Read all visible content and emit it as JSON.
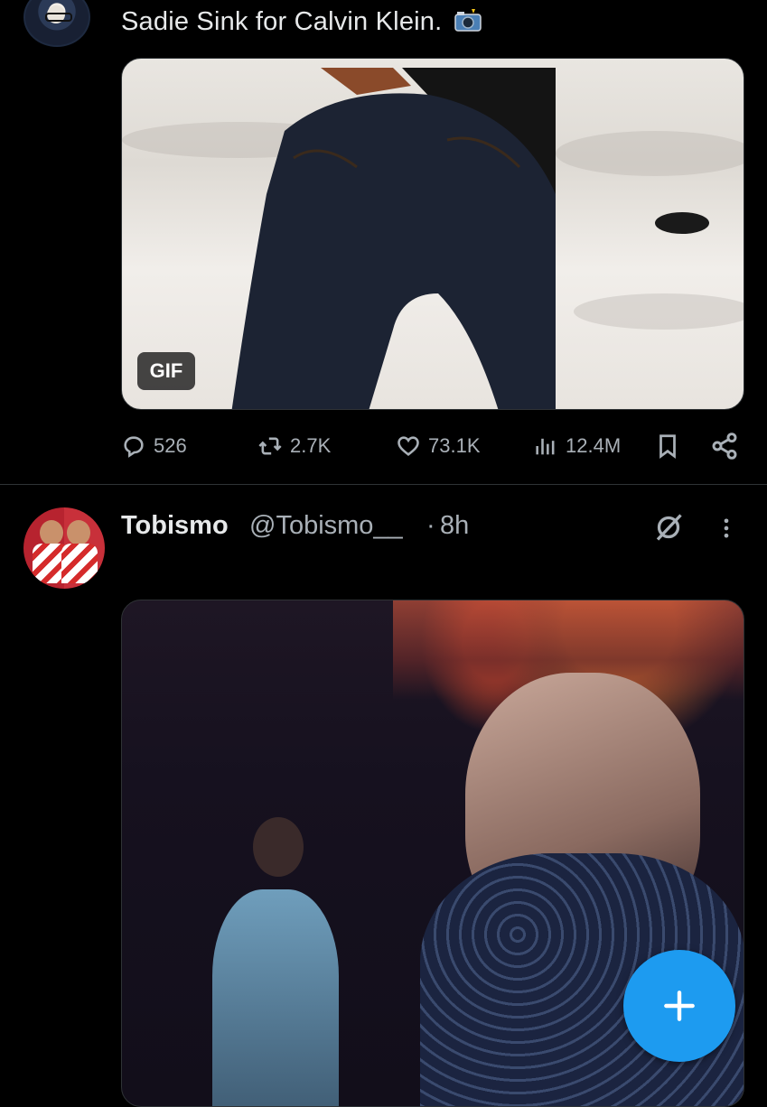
{
  "tweet1": {
    "text": "Sadie Sink for Calvin Klein.",
    "media_badge": "GIF",
    "stats": {
      "replies": "526",
      "retweets": "2.7K",
      "likes": "73.1K",
      "views": "12.4M"
    }
  },
  "tweet2": {
    "author_name": "Tobismo",
    "handle": "@Tobismo__",
    "separator": "·",
    "time": "8h"
  },
  "icons": {
    "reply": "reply-icon",
    "retweet": "retweet-icon",
    "like": "heart-icon",
    "views": "views-icon",
    "bookmark": "bookmark-icon",
    "share": "share-icon",
    "grok": "grok-icon",
    "more": "more-icon",
    "compose": "plus-icon"
  },
  "colors": {
    "background": "#000000",
    "text_primary": "#e7e9ea",
    "text_secondary": "#a9b0b7",
    "accent": "#1d9bf0"
  }
}
